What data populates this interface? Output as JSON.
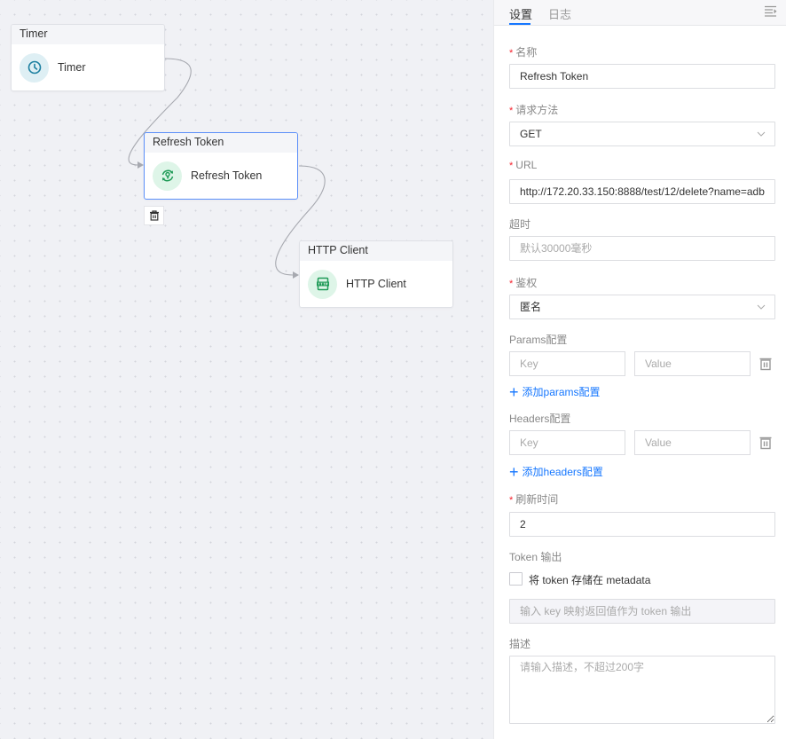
{
  "canvas": {
    "nodes": [
      {
        "id": "timer",
        "header": "Timer",
        "label": "Timer",
        "icon": "clock-icon",
        "icon_color": "#1b7fa0",
        "icon_bg": "#deeff4"
      },
      {
        "id": "refresh-token",
        "header": "Refresh Token",
        "label": "Refresh Token",
        "icon": "key-refresh-icon",
        "icon_color": "#1f9b57",
        "icon_bg": "#def5e8",
        "selected": true
      },
      {
        "id": "http-client",
        "header": "HTTP Client",
        "label": "HTTP Client",
        "icon": "http-icon",
        "icon_color": "#1f9b57",
        "icon_bg": "#def5e8"
      }
    ],
    "edges": [
      {
        "from": "timer",
        "to": "refresh-token"
      },
      {
        "from": "refresh-token",
        "to": "http-client"
      }
    ],
    "delete_icon": "trash-icon"
  },
  "panel": {
    "tabs": [
      {
        "label": "设置",
        "active": true
      },
      {
        "label": "日志",
        "active": false
      }
    ],
    "accent_color": "#1677ff",
    "fields": {
      "name": {
        "label": "名称",
        "required": true,
        "value": "Refresh Token"
      },
      "method": {
        "label": "请求方法",
        "required": true,
        "value": "GET"
      },
      "url": {
        "label": "URL",
        "required": true,
        "value": "http://172.20.33.150:8888/test/12/delete?name=adb"
      },
      "timeout": {
        "label": "超时",
        "required": false,
        "placeholder": "默认30000毫秒"
      },
      "auth": {
        "label": "鉴权",
        "required": true,
        "value": "匿名"
      },
      "params": {
        "label": "Params配置",
        "key_placeholder": "Key",
        "value_placeholder": "Value",
        "add_label": "添加params配置"
      },
      "headers": {
        "label": "Headers配置",
        "key_placeholder": "Key",
        "value_placeholder": "Value",
        "add_label": "添加headers配置"
      },
      "refresh_time": {
        "label": "刷新时间",
        "required": true,
        "value": "2"
      },
      "token_output": {
        "label": "Token 输出",
        "checkbox_label": "将 token 存储在 metadata",
        "checked": false,
        "placeholder": "输入 key 映射返回值作为 token 输出"
      },
      "description": {
        "label": "描述",
        "placeholder": "请输入描述，不超过200字"
      }
    },
    "required_mark": "*"
  }
}
